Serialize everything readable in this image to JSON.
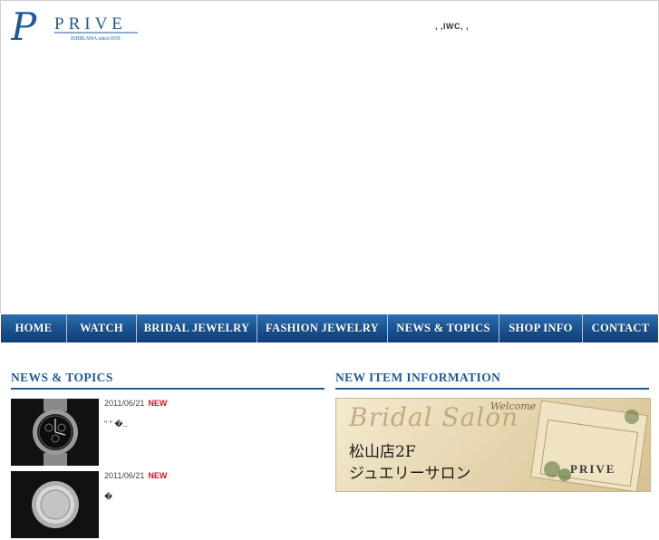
{
  "header": {
    "logo_letter": "P",
    "logo_name": "PRIVE",
    "logo_sub": "ISHIKAWA since1939",
    "tagline": ",   ,IWC,   ,"
  },
  "nav": {
    "items": [
      {
        "label": "HOME"
      },
      {
        "label": "WATCH"
      },
      {
        "label": "BRIDAL JEWELRY"
      },
      {
        "label": "FASHION  JEWELRY"
      },
      {
        "label": "NEWS & TOPICS"
      },
      {
        "label": "SHOP INFO"
      },
      {
        "label": "CONTACT"
      }
    ]
  },
  "news": {
    "heading": "NEWS & TOPICS",
    "items": [
      {
        "date": "2011/06/21",
        "badge": "NEW",
        "text": "\"           \"                                  �.."
      },
      {
        "date": "2011/06/21",
        "badge": "NEW",
        "text": "                                               �"
      }
    ]
  },
  "new_items": {
    "heading": "NEW ITEM INFORMATION",
    "banner": {
      "script": "Bridal Salon",
      "welcome": "Welcome",
      "line1": "松山店2F",
      "line2": "ジュエリーサロン",
      "brand": "PRIVE"
    }
  },
  "colors": {
    "nav_blue": "#18508e",
    "accent_blue": "#1d5a9a",
    "new_red": "#d0142a"
  }
}
